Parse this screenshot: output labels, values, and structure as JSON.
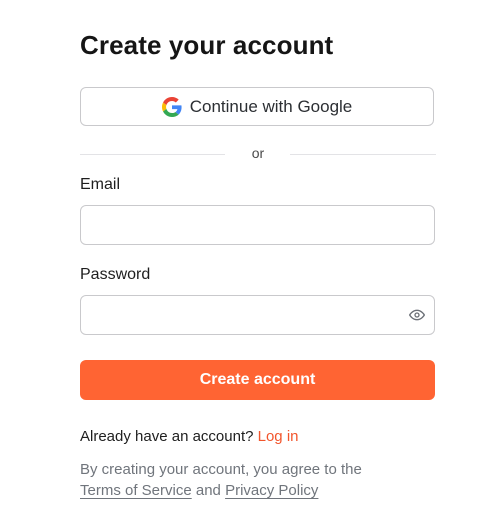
{
  "title": "Create your account",
  "google_button": {
    "label": "Continue with Google",
    "icon": "google-icon"
  },
  "divider": {
    "text": "or"
  },
  "email": {
    "label": "Email",
    "value": "",
    "placeholder": ""
  },
  "password": {
    "label": "Password",
    "value": "",
    "placeholder": "",
    "icon": "eye-icon"
  },
  "submit": {
    "label": "Create account"
  },
  "login": {
    "prompt": "Already have an account?",
    "link": "Log in"
  },
  "legal": {
    "line1": "By creating your account, you agree to the",
    "terms": "Terms of Service",
    "and": "and",
    "privacy": "Privacy Policy"
  },
  "colors": {
    "accent": "#ff6433",
    "link": "#f2552c",
    "border": "#c9c9cc",
    "muted_text": "#70757c"
  }
}
